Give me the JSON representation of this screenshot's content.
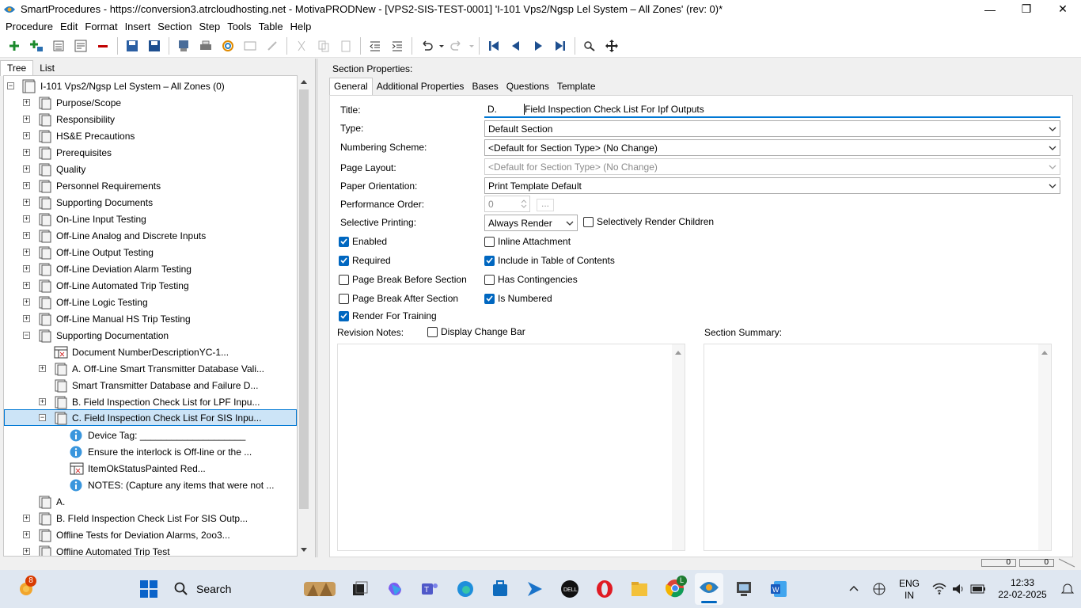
{
  "window": {
    "title": "SmartProcedures - https://conversion3.atrcloudhosting.net - MotivaPRODNew - [VPS2-SIS-TEST-0001] 'I-101 Vps2/Ngsp Lel System – All Zones' (rev: 0)*",
    "minimize": "—",
    "maximize": "❒",
    "close": "✕"
  },
  "menu": [
    "Procedure",
    "Edit",
    "Format",
    "Insert",
    "Section",
    "Step",
    "Tools",
    "Table",
    "Help"
  ],
  "left_tabs": [
    "Tree",
    "List"
  ],
  "tree": {
    "root": "I-101 Vps2/Ngsp Lel System – All Zones (0)",
    "items": [
      "Purpose/Scope",
      "Responsibility",
      "HS&E Precautions",
      "Prerequisites",
      "Quality",
      "Personnel Requirements",
      "Supporting Documents",
      "On-Line Input Testing",
      "Off-Line Analog and Discrete Inputs",
      "Off-Line Output Testing",
      "Off-Line Deviation Alarm Testing",
      "Off-Line Automated Trip Testing",
      "Off-Line Logic Testing",
      "Off-Line Manual HS Trip Testing",
      "Supporting Documentation",
      "Document NumberDescriptionYC-1...",
      "A. Off-Line Smart Transmitter Database Vali...",
      "Smart Transmitter Database and Failure D...",
      "B. Field Inspection Check List for LPF Inpu...",
      "C. Field Inspection Check List For SIS Inpu...",
      "Device Tag: ____________________",
      "Ensure the interlock is Off-line or the ...",
      "ItemOkStatusPainted Red...",
      "NOTES: (Capture any items that were not ...",
      "A.",
      "B. FIeld Inspection Check List For SIS Outp...",
      "Offline Tests for Deviation Alarms, 2oo3...",
      "Offline Automated Trip Test"
    ]
  },
  "props": {
    "heading": "Section Properties:",
    "tabs": [
      "General",
      "Additional Properties",
      "Bases",
      "Questions",
      "Template"
    ],
    "labels": {
      "title": "Title:",
      "type": "Type:",
      "numbering": "Numbering Scheme:",
      "layout": "Page Layout:",
      "orientation": "Paper Orientation:",
      "perf_order": "Performance Order:",
      "selective": "Selective Printing:",
      "revision_notes": "Revision Notes:",
      "section_summary": "Section Summary:"
    },
    "values": {
      "title_prefix": "D.",
      "title": "Field Inspection Check List For Ipf Outputs",
      "type": "Default Section",
      "numbering": "<Default for Section Type> (No Change)",
      "layout": "<Default for Section Type> (No Change)",
      "orientation": "Print Template Default",
      "perf_order": "0",
      "perf_order_btn": "...",
      "selective": "Always Render"
    },
    "checks": {
      "selectively_render_children": "Selectively Render Children",
      "enabled": "Enabled",
      "inline_attachment": "Inline Attachment",
      "required": "Required",
      "include_toc": "Include in Table of Contents",
      "page_break_before": "Page Break Before Section",
      "has_contingencies": "Has Contingencies",
      "page_break_after": "Page Break After Section",
      "is_numbered": "Is Numbered",
      "render_for_training": "Render For Training",
      "display_change_bar": "Display Change Bar"
    },
    "status_values": [
      "0",
      "0"
    ]
  },
  "taskbar": {
    "badge": "8",
    "search": "Search",
    "lang_top": "ENG",
    "lang_bottom": "IN",
    "time": "12:33",
    "date": "22-02-2025",
    "chrome_badge": "L"
  }
}
